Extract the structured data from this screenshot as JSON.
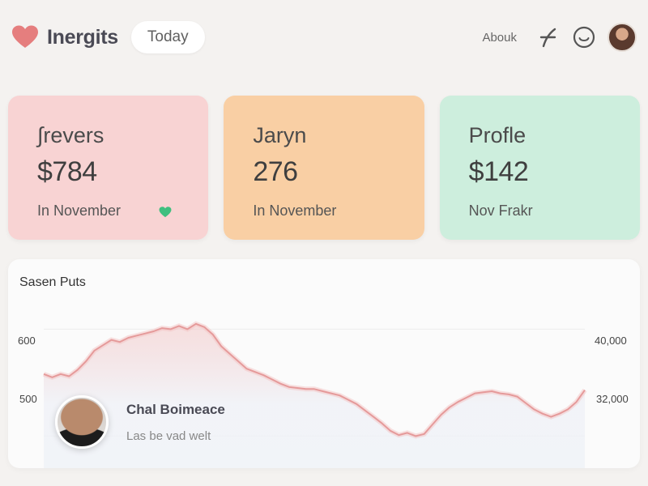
{
  "header": {
    "app_title": "Inergits",
    "period_pill": "Today",
    "about_link": "Abouk",
    "icons": [
      "heart-logo-icon",
      "feather-icon",
      "smile-icon",
      "avatar"
    ]
  },
  "cards": [
    {
      "title": "∫revers",
      "value": "$784",
      "sub": "In November",
      "color": "#f8d3d3",
      "marker": "heart"
    },
    {
      "title": "Jaryn",
      "value": "276",
      "sub": "In November",
      "color": "#f9cfa4"
    },
    {
      "title": "Profle",
      "value": "$142",
      "sub": "Nov Frakr",
      "color": "#cdeedd"
    }
  ],
  "chart_panel": {
    "title": "Sasen Puts",
    "y_left_ticks": [
      "600",
      "500"
    ],
    "y_right_ticks": [
      "40,000",
      "32,000"
    ],
    "user": {
      "name": "Chal Boimeace",
      "subtitle": "Las be vad welt"
    }
  },
  "chart_data": {
    "type": "area",
    "title": "Sasen Puts",
    "xlabel": "",
    "ylabel": "",
    "ylim": [
      470,
      620
    ],
    "y_left_ticks": [
      600,
      500
    ],
    "series": [
      {
        "color": "#e59a9a",
        "values": [
          558,
          555,
          558,
          556,
          562,
          570,
          580,
          585,
          590,
          588,
          592,
          594,
          596,
          598,
          601,
          600,
          603,
          600,
          605,
          602,
          595,
          584,
          577,
          570,
          563,
          560,
          557,
          553,
          549,
          546,
          545,
          544,
          544,
          542,
          540,
          538,
          534,
          530,
          524,
          518,
          512,
          505,
          501,
          503,
          500,
          502,
          511,
          520,
          527,
          532,
          536,
          540,
          541,
          542,
          540,
          539,
          537,
          531,
          525,
          521,
          518,
          521,
          525,
          532,
          543
        ]
      }
    ]
  },
  "colors": {
    "heart": "#e57e7e",
    "mini_heart": "#3fbf7f",
    "line": "#e59a9a",
    "background": "#f4f2f0"
  }
}
